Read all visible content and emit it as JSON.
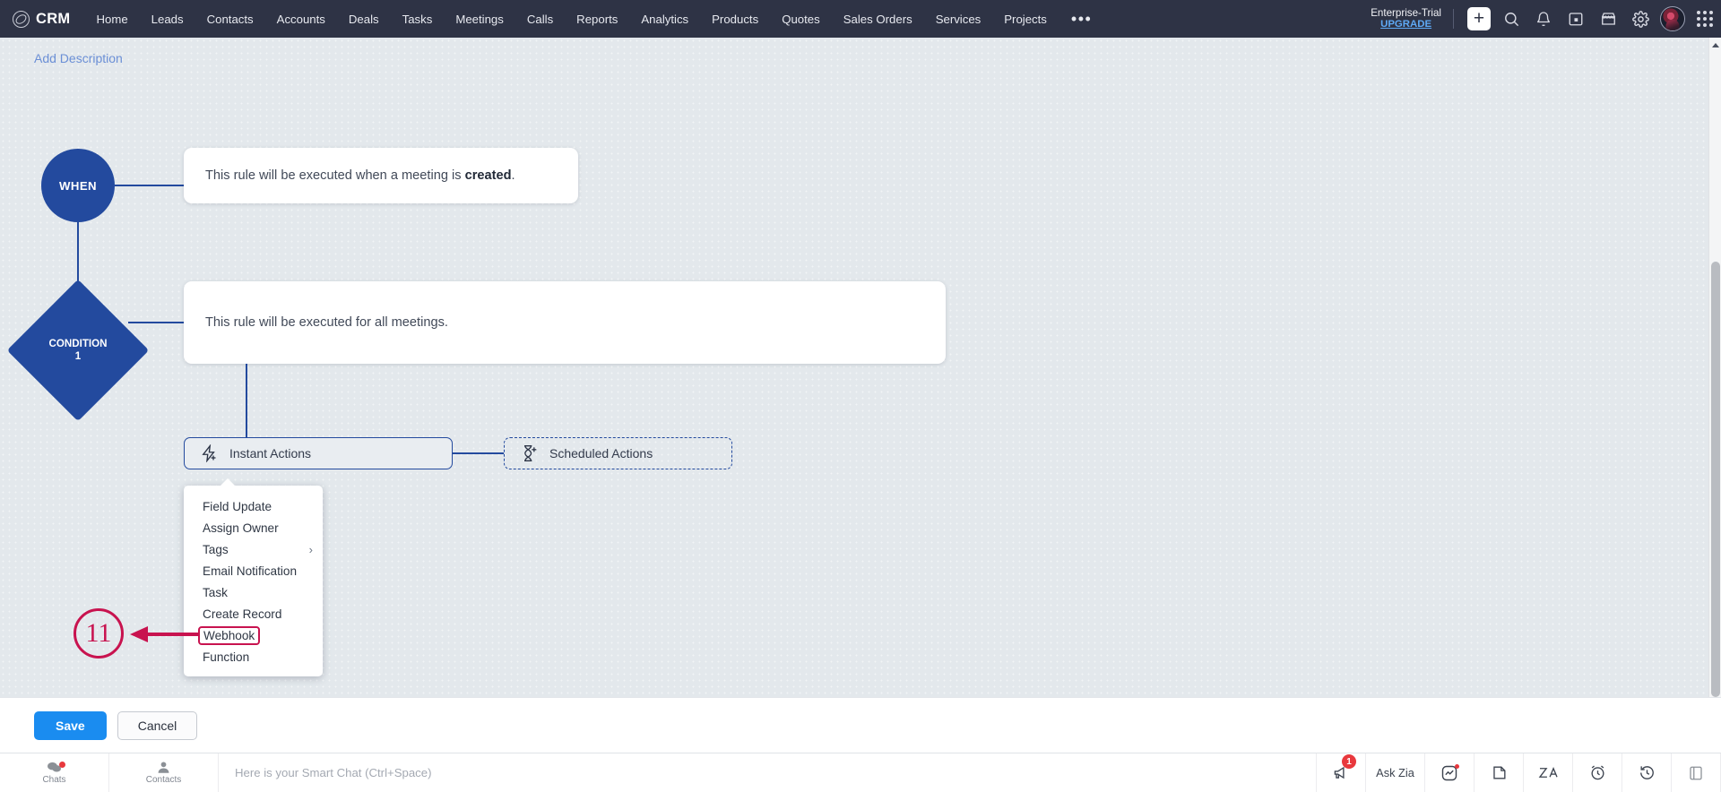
{
  "topnav": {
    "brand": "CRM",
    "items": [
      {
        "label": "Home"
      },
      {
        "label": "Leads"
      },
      {
        "label": "Contacts"
      },
      {
        "label": "Accounts"
      },
      {
        "label": "Deals"
      },
      {
        "label": "Tasks"
      },
      {
        "label": "Meetings"
      },
      {
        "label": "Calls"
      },
      {
        "label": "Reports"
      },
      {
        "label": "Analytics"
      },
      {
        "label": "Products"
      },
      {
        "label": "Quotes"
      },
      {
        "label": "Sales Orders"
      },
      {
        "label": "Services"
      },
      {
        "label": "Projects"
      }
    ],
    "more": "•••",
    "trial_label": "Enterprise-Trial",
    "upgrade_label": "UPGRADE",
    "icons": [
      "plus-icon",
      "search-icon",
      "bell-icon",
      "calendar-icon",
      "store-icon",
      "gear-icon",
      "avatar",
      "apps-grid-icon"
    ]
  },
  "canvas": {
    "add_description": "Add Description",
    "when_node": "WHEN",
    "condition_node_line1": "CONDITION",
    "condition_node_line2": "1",
    "when_card_prefix": "This rule will be executed when a meeting is ",
    "when_card_bold": "created",
    "when_card_suffix": ".",
    "condition_card": "This rule will be executed for all meetings.",
    "instant_actions": "Instant Actions",
    "scheduled_actions": "Scheduled Actions",
    "accent_blue": "#234a9e",
    "background": "#e3e8ec"
  },
  "menu": {
    "items": [
      {
        "label": "Field Update",
        "has_submenu": false,
        "highlighted": false
      },
      {
        "label": "Assign Owner",
        "has_submenu": false,
        "highlighted": false
      },
      {
        "label": "Tags",
        "has_submenu": true,
        "highlighted": false
      },
      {
        "label": "Email Notification",
        "has_submenu": false,
        "highlighted": false
      },
      {
        "label": "Task",
        "has_submenu": false,
        "highlighted": false
      },
      {
        "label": "Create Record",
        "has_submenu": false,
        "highlighted": false
      },
      {
        "label": "Webhook",
        "has_submenu": false,
        "highlighted": true
      },
      {
        "label": "Function",
        "has_submenu": false,
        "highlighted": false
      }
    ],
    "chevron": "›"
  },
  "annotation": {
    "step_number": "11",
    "color": "#c8134f"
  },
  "footer": {
    "save_label": "Save",
    "cancel_label": "Cancel"
  },
  "statusbar": {
    "chats_label": "Chats",
    "contacts_label": "Contacts",
    "chat_placeholder": "Here is your Smart Chat (Ctrl+Space)",
    "announcement_badge": "1",
    "ask_zia_label": "Ask Zia"
  }
}
